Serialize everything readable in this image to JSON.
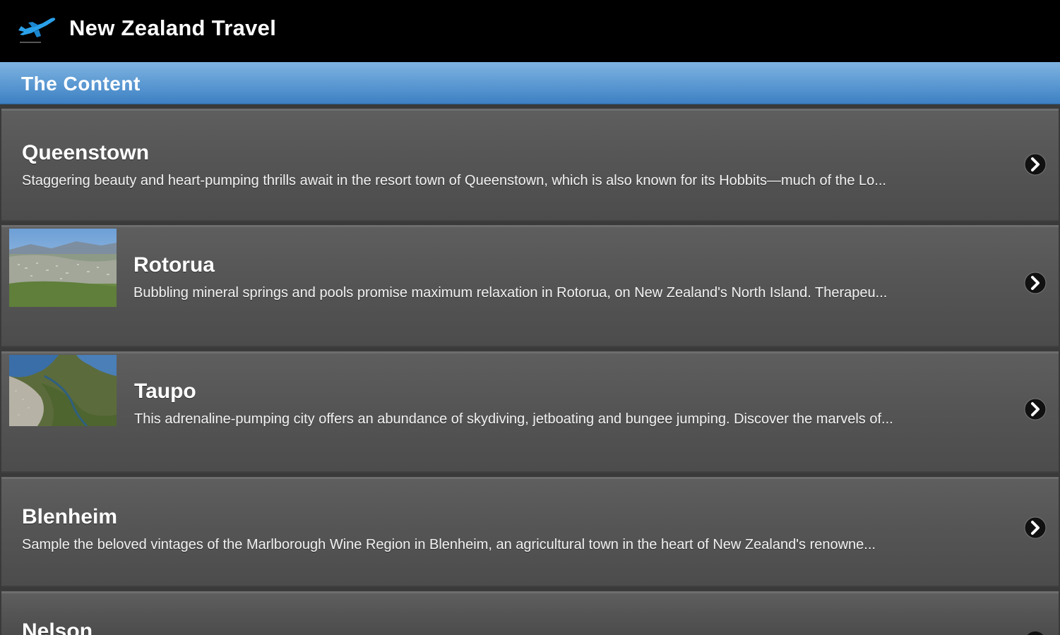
{
  "app": {
    "title": "New Zealand Travel",
    "icon": "airplane-icon"
  },
  "section": {
    "title": "The Content"
  },
  "colors": {
    "action_bar": "#000000",
    "section_header": "#5a98d2",
    "list_item": "#555555",
    "text": "#ffffff"
  },
  "items": [
    {
      "title": "Queenstown",
      "description": "Staggering beauty and heart-pumping thrills await in the resort town of Queenstown, which is also known for its Hobbits—much of the Lo...",
      "has_image": false,
      "icon": "chevron-right-icon"
    },
    {
      "title": "Rotorua",
      "description": "Bubbling mineral springs and pools promise maximum relaxation in Rotorua, on New Zealand's North Island. Therapeu...",
      "has_image": true,
      "icon": "chevron-right-icon"
    },
    {
      "title": "Taupo",
      "description": "This adrenaline-pumping city offers an abundance of skydiving, jetboating and bungee jumping. Discover the marvels of...",
      "has_image": true,
      "icon": "chevron-right-icon"
    },
    {
      "title": "Blenheim",
      "description": "Sample the beloved vintages of the Marlborough Wine Region in Blenheim, an agricultural town in the heart of New Zealand's renowne...",
      "has_image": false,
      "icon": "chevron-right-icon"
    },
    {
      "title": "Nelson",
      "description": "",
      "has_image": false,
      "icon": "chevron-right-icon"
    }
  ]
}
